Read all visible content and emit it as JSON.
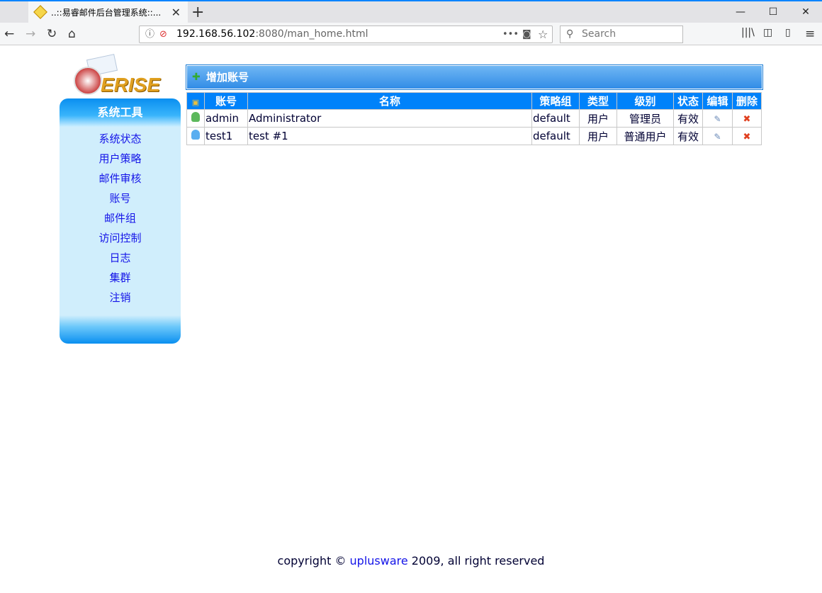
{
  "browser": {
    "tab_title": "..::易睿邮件后台管理系统::...",
    "url_host": "192.168.56.102",
    "url_path": ":8080/man_home.html",
    "search_placeholder": "Search"
  },
  "logo": {
    "text": "ERISE"
  },
  "sidebar": {
    "title": "系统工具",
    "items": [
      "系统状态",
      "用户策略",
      "邮件审核",
      "账号",
      "邮件组",
      "访问控制",
      "日志",
      "集群",
      "注销"
    ]
  },
  "main": {
    "add_label": "增加账号",
    "columns": [
      "账号",
      "名称",
      "策略组",
      "类型",
      "级别",
      "状态",
      "编辑",
      "删除"
    ],
    "rows": [
      {
        "account": "admin",
        "name": "Administrator",
        "policy": "default",
        "type": "用户",
        "level": "管理员",
        "status": "有效",
        "icon_color": "#5cb85c"
      },
      {
        "account": "test1",
        "name": "test #1",
        "policy": "default",
        "type": "用户",
        "level": "普通用户",
        "status": "有效",
        "icon_color": "#5aaef0"
      }
    ]
  },
  "footer": {
    "pre": "copyright © ",
    "link": "uplusware",
    "post": " 2009, all right reserved"
  }
}
